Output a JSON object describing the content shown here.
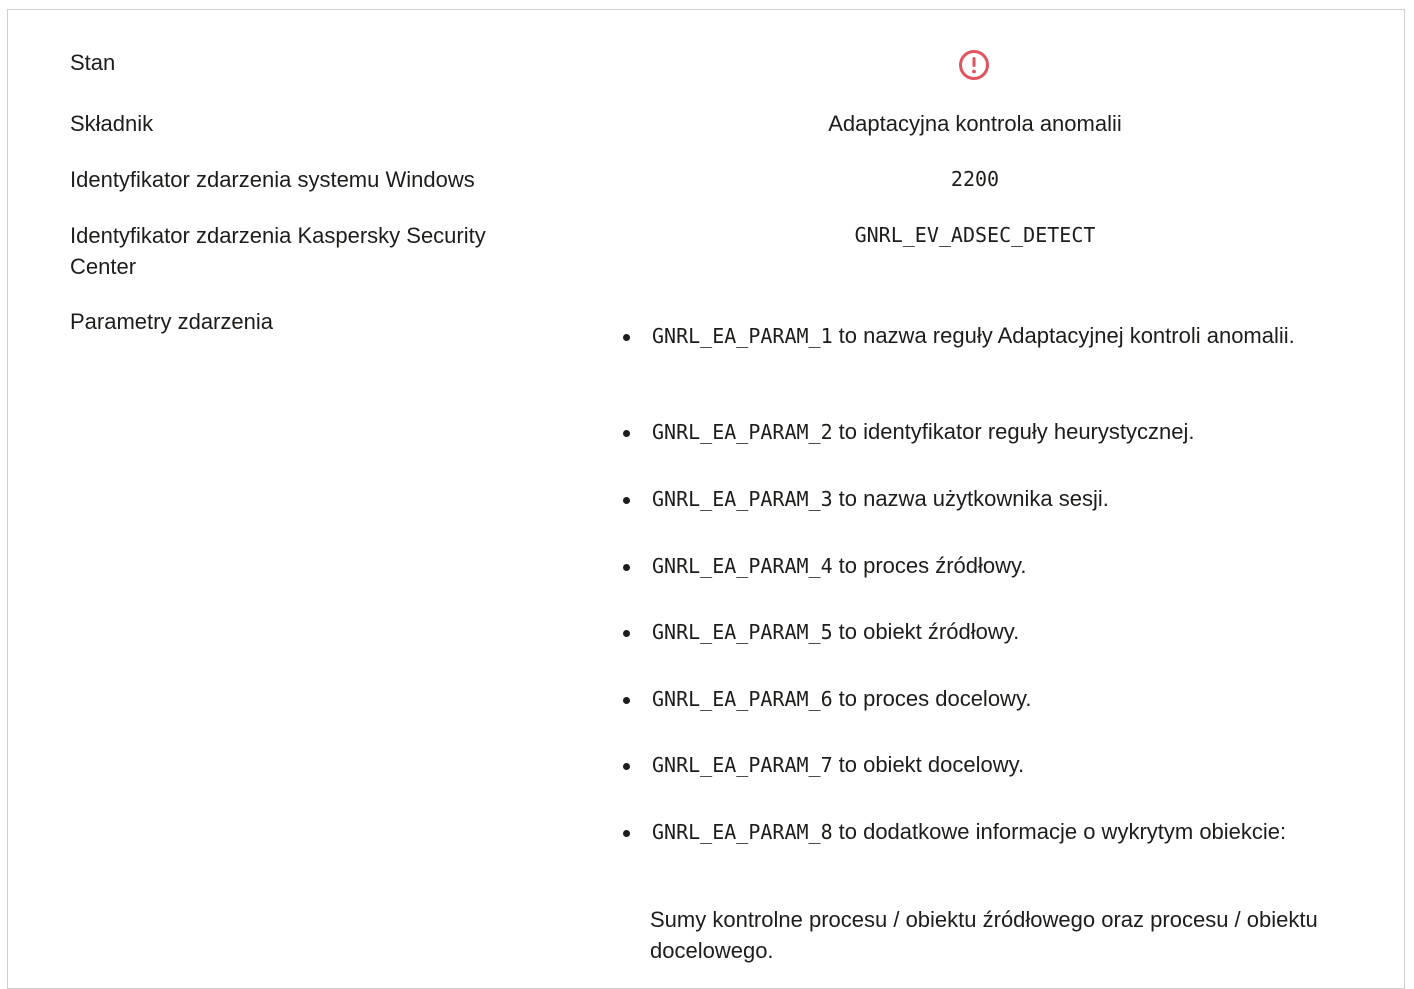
{
  "rows": {
    "status": {
      "label": "Stan",
      "icon": "exclamation-circle-icon",
      "icon_color": "#e0535f"
    },
    "component": {
      "label": "Składnik",
      "value": "Adaptacyjna kontrola anomalii"
    },
    "windows_event_id": {
      "label": "Identyfikator zdarzenia systemu Windows",
      "value": "2200"
    },
    "ksc_event_id": {
      "label": "Identyfikator zdarzenia Kaspersky Security Center",
      "value": "GNRL_EV_ADSEC_DETECT"
    },
    "event_params": {
      "label": "Parametry zdarzenia"
    }
  },
  "params": [
    {
      "code": "GNRL_EA_PARAM_1",
      "desc": "to nazwa reguły Adaptacyjnej kontroli anomalii."
    },
    {
      "code": "GNRL_EA_PARAM_2",
      "desc": "to identyfikator reguły heurystycznej."
    },
    {
      "code": "GNRL_EA_PARAM_3",
      "desc": "to nazwa użytkownika sesji."
    },
    {
      "code": "GNRL_EA_PARAM_4",
      "desc": "to proces źródłowy."
    },
    {
      "code": "GNRL_EA_PARAM_5",
      "desc": "to obiekt źródłowy."
    },
    {
      "code": "GNRL_EA_PARAM_6",
      "desc": "to proces docelowy."
    },
    {
      "code": "GNRL_EA_PARAM_7",
      "desc": "to obiekt docelowy."
    },
    {
      "code": "GNRL_EA_PARAM_8",
      "desc": "to dodatkowe informacje o wykrytym obiekcie:"
    }
  ],
  "param8_extra": "Sumy kontrolne procesu / obiektu źródłowego oraz procesu / obiektu docelowego."
}
